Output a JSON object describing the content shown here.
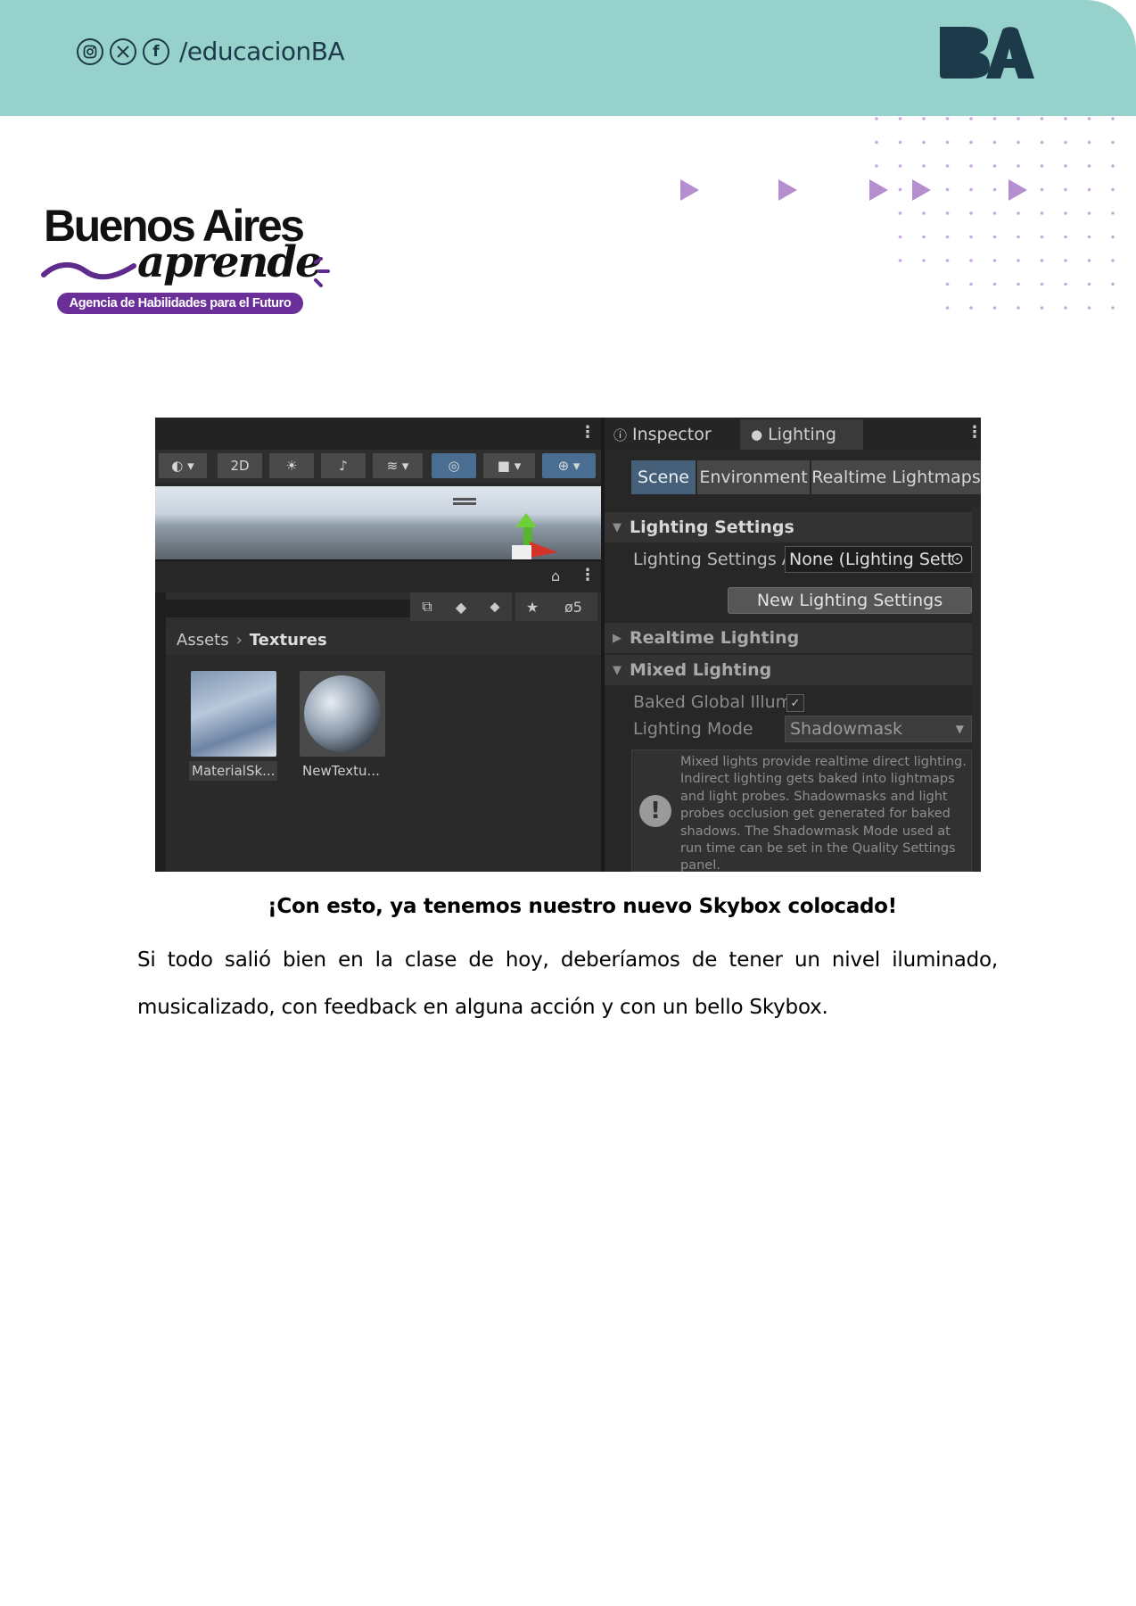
{
  "header": {
    "social_handle": "/educacionBA",
    "icons": [
      "instagram-icon",
      "x-twitter-icon",
      "facebook-icon"
    ],
    "ba_logo_text": "BA",
    "band_color": "#96d1cb",
    "text_color": "#1d3a4a"
  },
  "brand": {
    "title": "Buenos Aires",
    "subtitle": "aprende",
    "tagline": "Agencia de Habilidades para el Futuro",
    "tag_color": "#6b2f99"
  },
  "decor": {
    "accent_color": "#b58ed0"
  },
  "screenshot": {
    "scene_toolbar": {
      "mode_2d": "2D"
    },
    "hidden_count": "5",
    "breadcrumb": {
      "root": "Assets",
      "folder": "Textures"
    },
    "assets": [
      "MaterialSk...",
      "NewTextu..."
    ],
    "tabs": [
      "Inspector",
      "Lighting"
    ],
    "segments": [
      "Scene",
      "Environment",
      "Realtime Lightmaps"
    ],
    "lighting_settings": {
      "header": "Lighting Settings",
      "asset_label": "Lighting Settings A",
      "asset_value": "None (Lighting Sett",
      "new_button": "New Lighting Settings"
    },
    "realtime_lighting": {
      "header": "Realtime Lighting"
    },
    "mixed_lighting": {
      "header": "Mixed Lighting",
      "baked_label": "Baked Global Illum",
      "baked_checked": "✓",
      "mode_label": "Lighting Mode",
      "mode_value": "Shadowmask",
      "help_text": "Mixed lights provide realtime direct lighting. Indirect lighting gets baked into lightmaps and light probes. Shadowmasks and light probes occlusion get generated for baked shadows. The Shadowmask Mode used at run time can be set in the Quality Settings panel."
    }
  },
  "content": {
    "caption": "¡Con esto, ya tenemos nuestro nuevo Skybox colocado!",
    "paragraph": "Si todo salió bien en la clase de hoy, deberíamos de tener un nivel iluminado, musicalizado, con feedback en alguna acción y con un bello Skybox."
  }
}
